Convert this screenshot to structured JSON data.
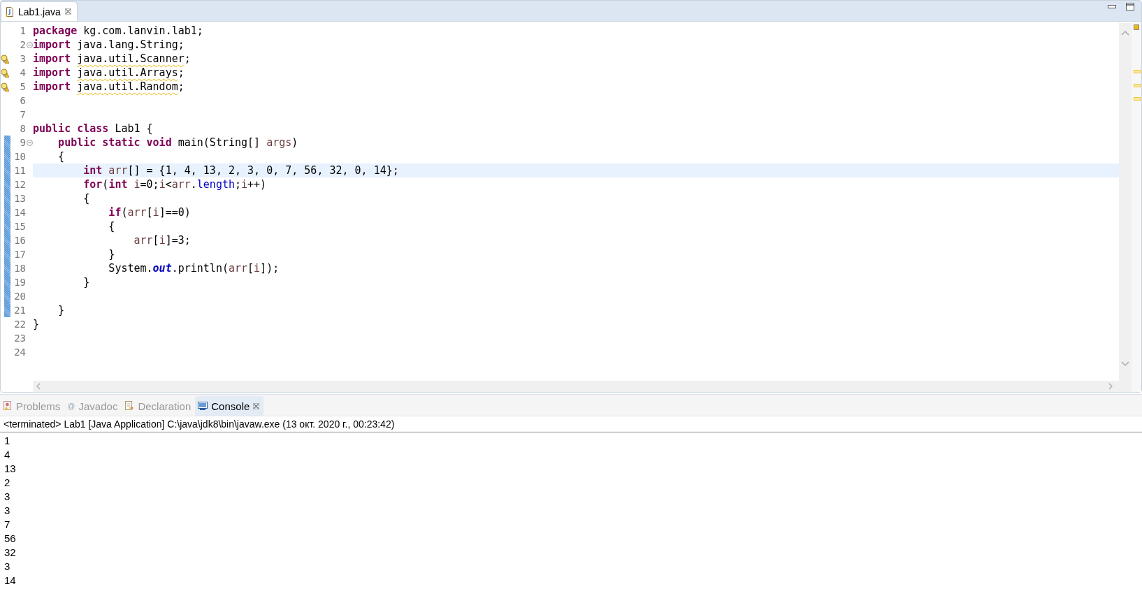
{
  "editor": {
    "tabs": [
      {
        "label": "Lab1.java",
        "selected": true,
        "kind": "java-file",
        "closable": true
      }
    ],
    "lines": [
      {
        "number": "1",
        "warning": false,
        "foldable": false,
        "changed": false,
        "current": false,
        "tokens": [
          {
            "kind": "keyword",
            "text": "package"
          },
          {
            "kind": "plain",
            "text": " kg.com.lanvin.lab1;"
          }
        ]
      },
      {
        "number": "2",
        "warning": false,
        "foldable": true,
        "changed": false,
        "current": false,
        "tokens": [
          {
            "kind": "keyword",
            "text": "import"
          },
          {
            "kind": "plain",
            "text": " java.lang.String;"
          }
        ]
      },
      {
        "number": "3",
        "warning": true,
        "foldable": false,
        "changed": false,
        "current": false,
        "tokens": [
          {
            "kind": "keyword",
            "text": "import "
          },
          {
            "kind": "plain",
            "text": "java.util.Scanner",
            "squiggle": true
          },
          {
            "kind": "plain",
            "text": ";"
          }
        ]
      },
      {
        "number": "4",
        "warning": true,
        "foldable": false,
        "changed": false,
        "current": false,
        "tokens": [
          {
            "kind": "keyword",
            "text": "import "
          },
          {
            "kind": "plain",
            "text": "java.util.Arrays",
            "squiggle": true
          },
          {
            "kind": "plain",
            "text": ";"
          }
        ]
      },
      {
        "number": "5",
        "warning": true,
        "foldable": false,
        "changed": false,
        "current": false,
        "tokens": [
          {
            "kind": "keyword",
            "text": "import "
          },
          {
            "kind": "plain",
            "text": "java.util.Random",
            "squiggle": true
          },
          {
            "kind": "plain",
            "text": ";"
          }
        ]
      },
      {
        "number": "6",
        "warning": false,
        "foldable": false,
        "changed": false,
        "current": false
      },
      {
        "number": "7",
        "warning": false,
        "foldable": false,
        "changed": false,
        "current": false
      },
      {
        "number": "8",
        "warning": false,
        "foldable": false,
        "changed": false,
        "current": false,
        "tokens": [
          {
            "kind": "keyword",
            "text": "public class"
          },
          {
            "kind": "plain",
            "text": " Lab1 {"
          }
        ]
      },
      {
        "number": "9",
        "warning": false,
        "foldable": true,
        "changed": true,
        "current": false,
        "tokens": [
          {
            "kind": "keyword",
            "text": "    public static void"
          },
          {
            "kind": "plain",
            "text": " main(String[] "
          },
          {
            "kind": "local",
            "text": "args"
          },
          {
            "kind": "plain",
            "text": ")"
          }
        ]
      },
      {
        "number": "10",
        "warning": false,
        "foldable": false,
        "changed": true,
        "current": false,
        "tokens": [
          {
            "kind": "plain",
            "text": "    {"
          }
        ]
      },
      {
        "number": "11",
        "warning": false,
        "foldable": false,
        "changed": true,
        "current": true,
        "tokens": [
          {
            "kind": "keyword",
            "text": "        int"
          },
          {
            "kind": "local",
            "text": " arr"
          },
          {
            "kind": "plain",
            "text": "[] = {1, 4, 13, 2, 3, 0, 7, 56, 32, 0, 14};"
          }
        ]
      },
      {
        "number": "12",
        "warning": false,
        "foldable": false,
        "changed": true,
        "current": false,
        "tokens": [
          {
            "kind": "keyword",
            "text": "        for"
          },
          {
            "kind": "plain",
            "text": "("
          },
          {
            "kind": "keyword",
            "text": "int"
          },
          {
            "kind": "local",
            "text": " i"
          },
          {
            "kind": "plain",
            "text": "=0;"
          },
          {
            "kind": "local",
            "text": "i"
          },
          {
            "kind": "plain",
            "text": "<"
          },
          {
            "kind": "local",
            "text": "arr"
          },
          {
            "kind": "plain",
            "text": "."
          },
          {
            "kind": "field",
            "text": "length"
          },
          {
            "kind": "plain",
            "text": ";"
          },
          {
            "kind": "local",
            "text": "i"
          },
          {
            "kind": "plain",
            "text": "++)"
          }
        ]
      },
      {
        "number": "13",
        "warning": false,
        "foldable": false,
        "changed": true,
        "current": false,
        "tokens": [
          {
            "kind": "plain",
            "text": "        {"
          }
        ]
      },
      {
        "number": "14",
        "warning": false,
        "foldable": false,
        "changed": true,
        "current": false,
        "tokens": [
          {
            "kind": "keyword",
            "text": "            if"
          },
          {
            "kind": "plain",
            "text": "("
          },
          {
            "kind": "local",
            "text": "arr"
          },
          {
            "kind": "plain",
            "text": "["
          },
          {
            "kind": "local",
            "text": "i"
          },
          {
            "kind": "plain",
            "text": "]==0)"
          }
        ]
      },
      {
        "number": "15",
        "warning": false,
        "foldable": false,
        "changed": true,
        "current": false,
        "tokens": [
          {
            "kind": "plain",
            "text": "            {"
          }
        ]
      },
      {
        "number": "16",
        "warning": false,
        "foldable": false,
        "changed": true,
        "current": false,
        "tokens": [
          {
            "kind": "local",
            "text": "                arr"
          },
          {
            "kind": "plain",
            "text": "["
          },
          {
            "kind": "local",
            "text": "i"
          },
          {
            "kind": "plain",
            "text": "]=3;"
          }
        ]
      },
      {
        "number": "17",
        "warning": false,
        "foldable": false,
        "changed": true,
        "current": false,
        "tokens": [
          {
            "kind": "plain",
            "text": "            }"
          }
        ]
      },
      {
        "number": "18",
        "warning": false,
        "foldable": false,
        "changed": true,
        "current": false,
        "tokens": [
          {
            "kind": "plain",
            "text": "            System."
          },
          {
            "kind": "static-field",
            "text": "out"
          },
          {
            "kind": "plain",
            "text": ".println("
          },
          {
            "kind": "local",
            "text": "arr"
          },
          {
            "kind": "plain",
            "text": "["
          },
          {
            "kind": "local",
            "text": "i"
          },
          {
            "kind": "plain",
            "text": "]);"
          }
        ]
      },
      {
        "number": "19",
        "warning": false,
        "foldable": false,
        "changed": true,
        "current": false,
        "tokens": [
          {
            "kind": "plain",
            "text": "        }"
          }
        ]
      },
      {
        "number": "20",
        "warning": false,
        "foldable": false,
        "changed": true,
        "current": false
      },
      {
        "number": "21",
        "warning": false,
        "foldable": false,
        "changed": true,
        "current": false,
        "tokens": [
          {
            "kind": "plain",
            "text": "    }"
          }
        ]
      },
      {
        "number": "22",
        "warning": false,
        "foldable": false,
        "changed": false,
        "current": false,
        "tokens": [
          {
            "kind": "plain",
            "text": "}"
          }
        ]
      },
      {
        "number": "23",
        "warning": false,
        "foldable": false,
        "changed": false,
        "current": false
      },
      {
        "number": "24",
        "warning": false,
        "foldable": false,
        "changed": false,
        "current": false
      }
    ]
  },
  "bottom_panel": {
    "tabs": [
      {
        "label": "Problems",
        "selected": false,
        "kind": "problems",
        "closable": false
      },
      {
        "label": "Javadoc",
        "selected": false,
        "kind": "glyph",
        "glyph": "@",
        "closable": false
      },
      {
        "label": "Declaration",
        "selected": false,
        "kind": "declaration",
        "closable": false
      },
      {
        "label": "Console",
        "selected": true,
        "kind": "console",
        "closable": true
      }
    ],
    "console_header": "<terminated> Lab1 [Java Application] C:\\java\\jdk8\\bin\\javaw.exe (13 окт. 2020 г., 00:23:42)",
    "output": [
      "1",
      "4",
      "13",
      "2",
      "3",
      "3",
      "7",
      "56",
      "32",
      "3",
      "14"
    ]
  }
}
